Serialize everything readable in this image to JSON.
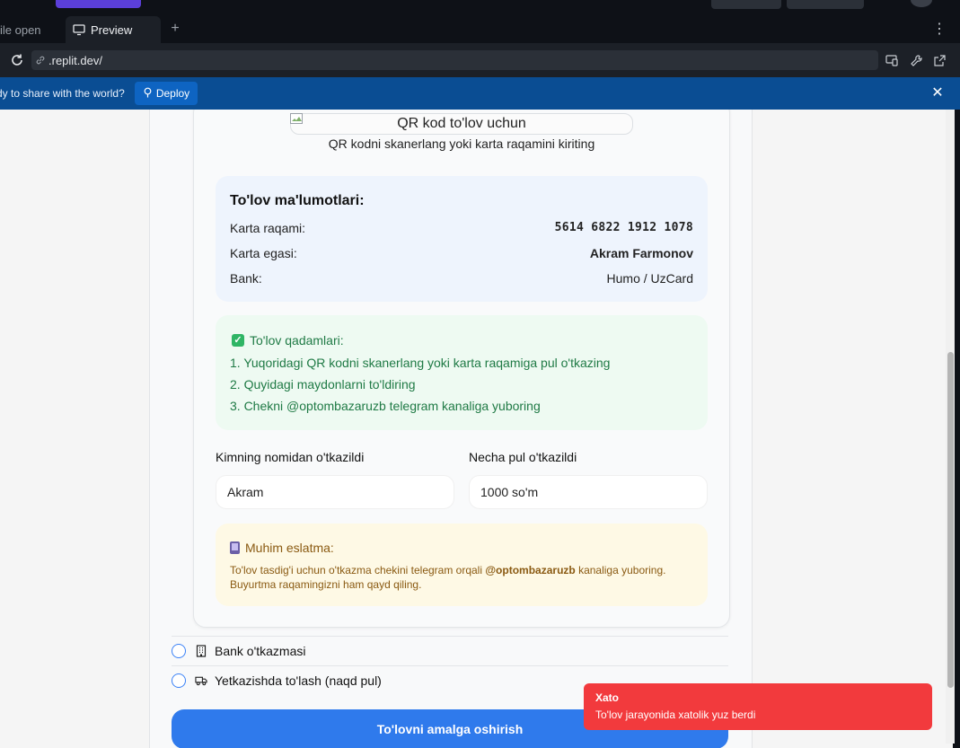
{
  "tabs": {
    "inactive_label": "ile open",
    "active_label": "Preview",
    "new_tab": "+"
  },
  "url": {
    "text": ".replit.dev/"
  },
  "banner": {
    "message": "dy to share with the world?",
    "deploy_label": "Deploy"
  },
  "qr": {
    "alt": "QR kod to'lov uchun",
    "hint": "QR kodni skanerlang yoki karta raqamini kiriting"
  },
  "info": {
    "title": "To'lov ma'lumotlari:",
    "rows": [
      {
        "label": "Karta raqami:",
        "value": "5614 6822 1912 1078"
      },
      {
        "label": "Karta egasi:",
        "value": "Akram Farmonov"
      },
      {
        "label": "Bank:",
        "value": "Humo / UzCard"
      }
    ]
  },
  "steps": {
    "title": "To'lov qadamlari:",
    "items": [
      "1. Yuqoridagi QR kodni skanerlang yoki karta raqamiga pul o'tkazing",
      "2. Quyidagi maydonlarni to'ldiring",
      "3. Chekni @optombazaruzb telegram kanaliga yuboring"
    ]
  },
  "form": {
    "name_label": "Kimning nomidan o'tkazildi",
    "name_value": "Akram",
    "amount_label": "Necha pul o'tkazildi",
    "amount_value": "1000 so'm"
  },
  "note": {
    "title": "Muhim eslatma:",
    "body_pre": "To'lov tasdig'i uchun o'tkazma chekini telegram orqali ",
    "body_bold": "@optombazaruzb",
    "body_post": " kanaliga yuboring. Buyurtma raqamingizni ham qayd qiling."
  },
  "payment_options": [
    {
      "label": "Bank o'tkazmasi",
      "icon": "building-icon"
    },
    {
      "label": "Yetkazishda to'lash (naqd pul)",
      "icon": "truck-icon"
    }
  ],
  "pay_button": "To'lovni amalga oshirish",
  "toast": {
    "title": "Xato",
    "message": "To'lov jarayonida xatolik yuz berdi"
  },
  "colors": {
    "accent": "#2f7aec",
    "error": "#f23a3d",
    "banner": "#0a4d93"
  }
}
